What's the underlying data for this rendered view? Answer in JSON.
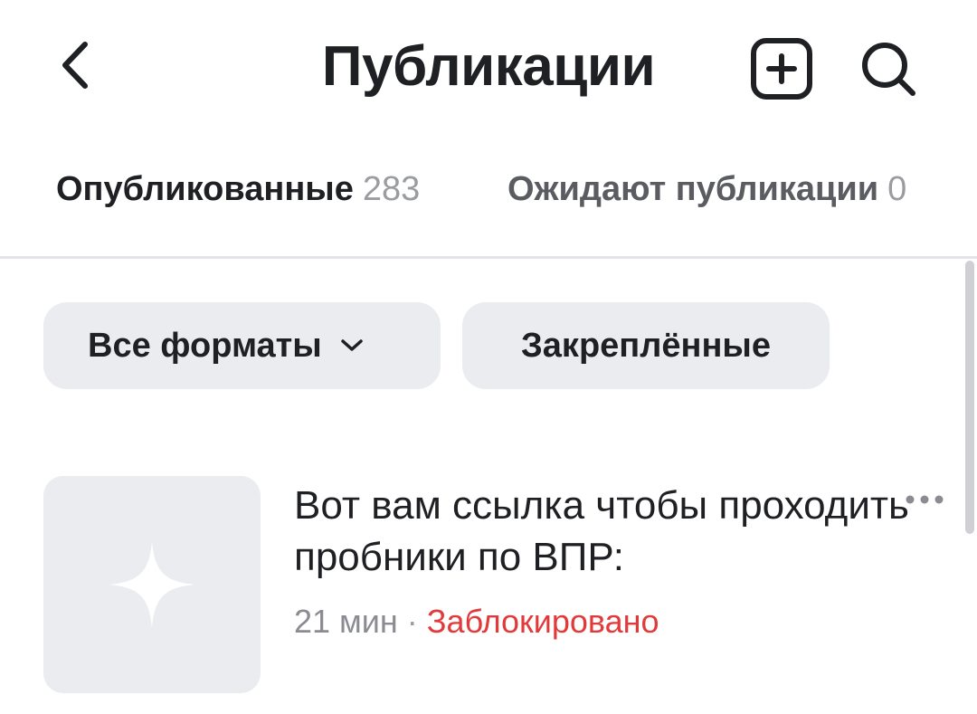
{
  "header": {
    "title": "Публикации",
    "back_icon": "chevron-left-icon",
    "add_icon": "plus-square-icon",
    "search_icon": "search-icon"
  },
  "tabs": [
    {
      "label": "Опубликованные",
      "count": "283",
      "active": true
    },
    {
      "label": "Ожидают публикации",
      "count": "0",
      "active": false
    }
  ],
  "filters": {
    "formats_label": "Все форматы",
    "formats_icon": "chevron-down-icon",
    "pinned_label": "Закреплённые"
  },
  "posts": [
    {
      "text": "Вот вам ссылка чтобы проходить пробники по ВПР:",
      "time": "21 мин",
      "separator": "·",
      "status": "Заблокировано",
      "thumbnail_icon": "sparkle-icon",
      "more_icon": "more-horizontal-icon"
    }
  ],
  "colors": {
    "text": "#1f2024",
    "muted": "#8a8c91",
    "chip_bg": "#ebecef",
    "status_blocked": "#e23a3a"
  }
}
